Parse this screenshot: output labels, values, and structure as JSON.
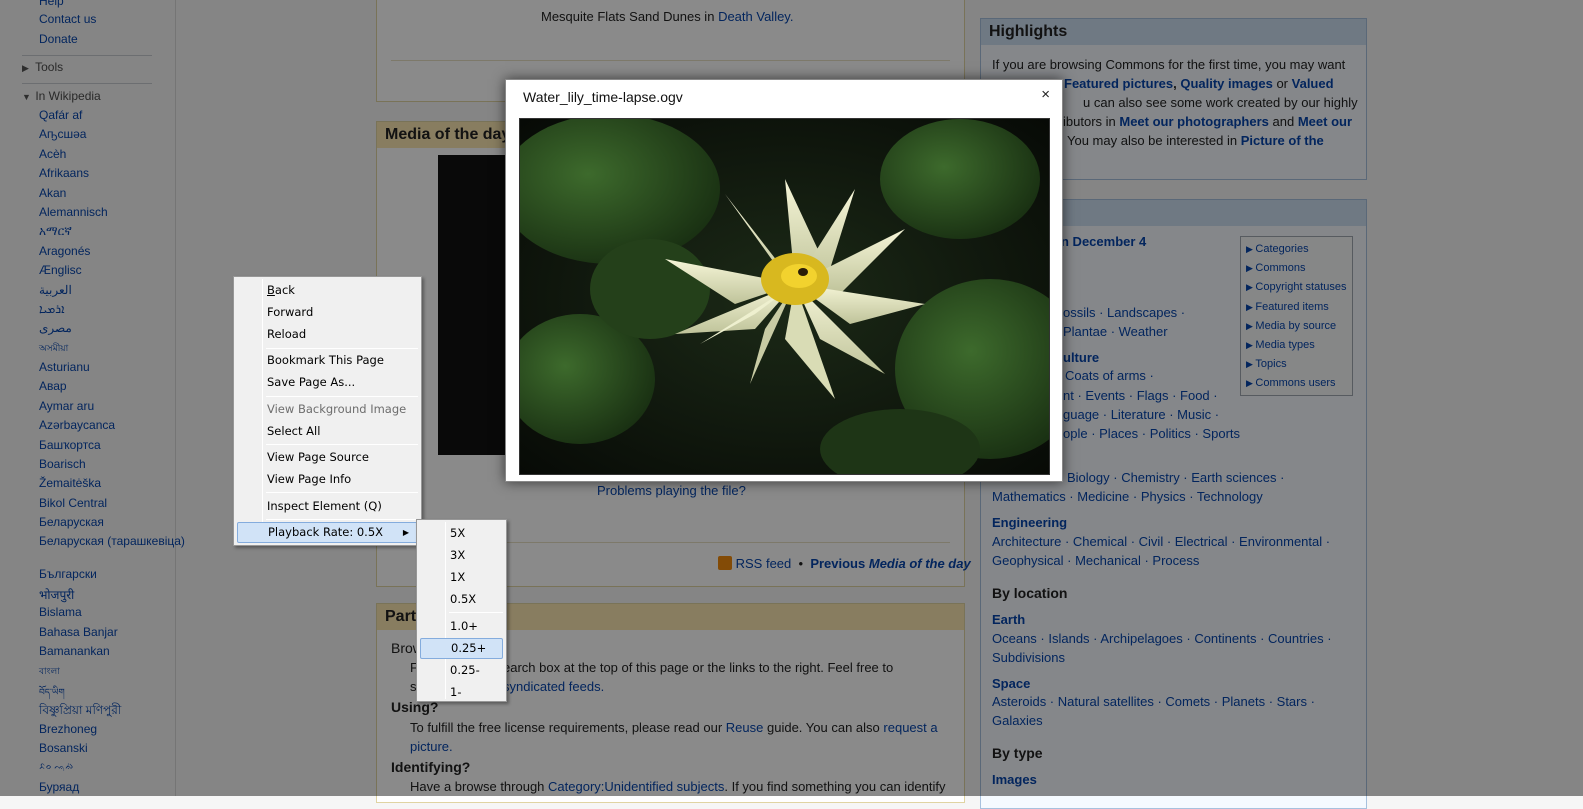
{
  "sidebar": {
    "top_links": [
      "Help",
      "Contact us",
      "Donate"
    ],
    "tools_label": "Tools",
    "in_wikipedia_label": "In Wikipedia",
    "languages": [
      "Qafár af",
      "Аҧсшәа",
      "Acèh",
      "Afrikaans",
      "Akan",
      "Alemannisch",
      "አማርኛ",
      "Aragonés",
      "Ænglisc",
      "العربية",
      "ܐܪܡܝܐ",
      "مصرى",
      "অসমীয়া",
      "Asturianu",
      "Авар",
      "Aymar aru",
      "Azərbaycanca",
      "Башҡортса",
      "Boarisch",
      "Žemaitėška",
      "Bikol Central",
      "Беларуская",
      "Беларуская (тарашкевіца)",
      "Български",
      "भोजपुरी",
      "Bislama",
      "Bahasa Banjar",
      "Bamanankan",
      "বাংলা",
      "བོད་ཡིག",
      "বিষ্ণুপ্রিয়া মণিপুরী",
      "Brezhoneg",
      "Bosanski",
      "ᨅᨔ ᨕᨘᨁᨗ",
      "Буряад"
    ]
  },
  "main": {
    "caption_text": "Mesquite Flats Sand Dunes in",
    "caption_link": "Death Valley.",
    "media_heading": "Media of the day",
    "problems_link": "Problems playing the file?",
    "rss_feed": "RSS feed",
    "bullet": "•",
    "previous_prefix": "Previous",
    "previous_italic": "Media of the day",
    "part_heading": "Part",
    "browsing_label": "Brow",
    "browse_text_1": "earch box at the top of this page or the links to the right. Feel free to",
    "browse_text_2": "syndicated feeds.",
    "browse_p1": "F",
    "browse_p2": "s",
    "using_label": "Using?",
    "using_text": "To fulfill the free license requirements, please read our",
    "reuse_link": "Reuse",
    "using_text_2": "guide. You can also",
    "request_link": "request a",
    "picture_link": "picture.",
    "identifying_label": "Identifying?",
    "identify_text": "Have a browse through",
    "identify_link": "Category:Unidentified subjects",
    "identify_text_2": ". If you find something you can identify"
  },
  "right": {
    "highlights_heading": "Highlights",
    "hl_line1": "If you are browsing Commons for the first time, you may want",
    "hl_featured": "Featured pictures",
    "hl_comma": ",",
    "hl_quality": "Quality images",
    "hl_or": "or",
    "hl_valued": "Valued",
    "hl_line3": "u can also see some work created by our highly",
    "hl_line4_a": "ibutors in",
    "hl_meet_photographers": "Meet our photographers",
    "hl_and": "and",
    "hl_meet_our": "Meet our",
    "hl_line5": "You may also be interested in",
    "hl_potd": "Picture of the",
    "dec4": "n December 4",
    "nature_1": "ossils · Landscapes ·",
    "nature_2": "Plantae · Weather",
    "culture_head": "ulture",
    "culture_1": "Coats of arms ·",
    "culture_2": "nt · Events · Flags · Food ·",
    "culture_3": "guage · Literature · Music ·",
    "culture_4": "ople · Places · Politics · Sports",
    "science_1": "Biology · Chemistry · Earth sciences ·",
    "science_2": "Mathematics · Medicine · Physics · Technology",
    "engineering_head": "Engineering",
    "engineering_1": "Architecture · Chemical · Civil · Electrical · Environmental ·",
    "engineering_2": "Geophysical · Mechanical · Process",
    "by_location": "By location",
    "earth_head": "Earth",
    "earth_1": "Oceans · Islands · Archipelagoes · Continents · Countries ·",
    "earth_2": "Subdivisions",
    "space_head": "Space",
    "space_1": "Asteroids · Natural satellites · Comets · Planets · Stars ·",
    "space_2": "Galaxies",
    "by_type": "By type",
    "images_head": "Images",
    "categories": [
      "Categories",
      "Commons",
      "Copyright statuses",
      "Featured items",
      "Media by source",
      "Media types",
      "Topics",
      "Commons users"
    ]
  },
  "dialog": {
    "title": "Water_lily_time-lapse.ogv",
    "close": "×"
  },
  "context_menu": {
    "back": "Back",
    "forward": "Forward",
    "reload": "Reload",
    "bookmark": "Bookmark This Page",
    "save_as": "Save Page As...",
    "view_bg": "View Background Image",
    "select_all": "Select All",
    "view_source": "View Page Source",
    "view_info": "View Page Info",
    "inspect": "Inspect Element (Q)",
    "playback": "Playback Rate: 0.5X"
  },
  "submenu": {
    "items": [
      "5X",
      "3X",
      "1X",
      "0.5X",
      "1.0+",
      "0.25+",
      "0.25-",
      "1-"
    ],
    "selected": "0.25+"
  }
}
